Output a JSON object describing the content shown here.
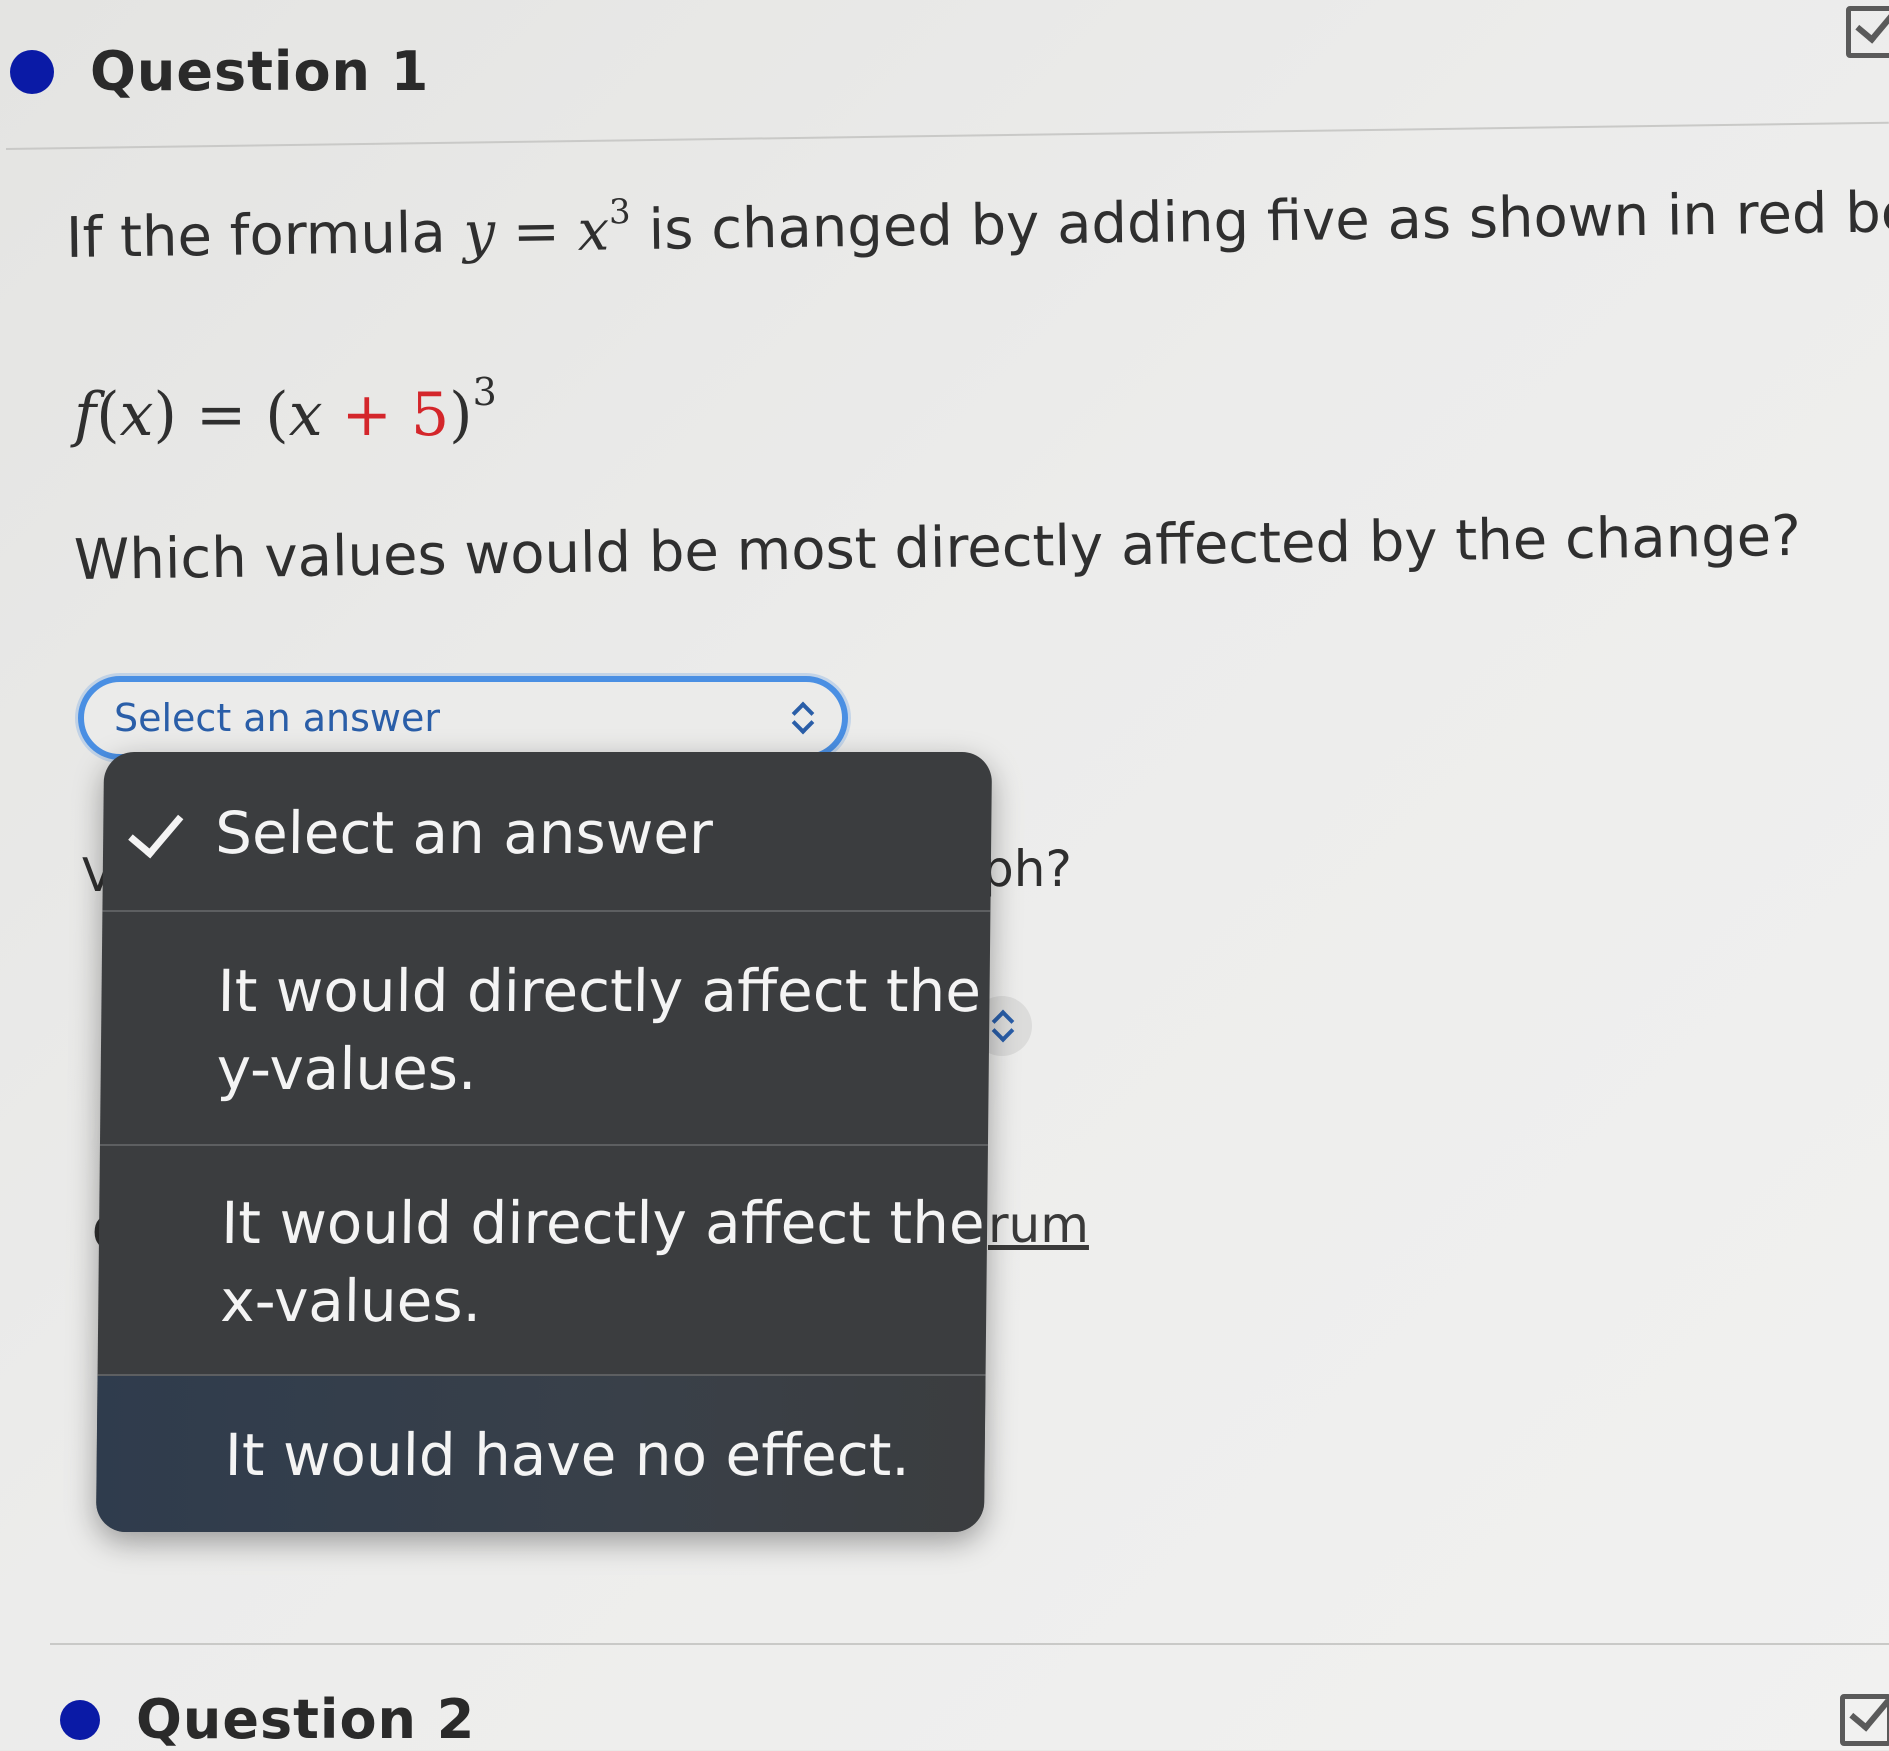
{
  "question1": {
    "title": "Question 1",
    "prompt_before": "If the formula ",
    "prompt_math_y": "y",
    "prompt_math_eq": " = ",
    "prompt_math_x": "x",
    "prompt_math_exp": "3",
    "prompt_after": " is changed by adding five as shown in red below.",
    "formula_left": "f",
    "formula_paren_open": "(",
    "formula_x": "x",
    "formula_paren_close": ") = (",
    "formula_x2": "x",
    "formula_added": " + 5",
    "formula_close": ")",
    "formula_exp": "3",
    "question_text": "Which values would be most directly affected by the change?",
    "select": {
      "selected_label": "Select an answer"
    },
    "menu": {
      "options": [
        {
          "label": "Select an answer",
          "checked": true
        },
        {
          "label": "It would directly affect the",
          "label_line2": "y-values."
        },
        {
          "label": "It would directly affect the",
          "label_line2": "x-values."
        },
        {
          "label": "It would have no effect."
        }
      ]
    },
    "background_fragments": {
      "ph": "ph?",
      "rum": "rum",
      "v": "V",
      "c": "C"
    }
  },
  "question2": {
    "title": "Question 2"
  },
  "colors": {
    "accent_blue": "#4a8fe3",
    "bullet": "#0a1aa6",
    "formula_red": "#d4262b",
    "menu_bg": "#3b3d3f"
  },
  "icons": [
    "bullet-dot-icon",
    "checkbox-icon",
    "updown-chevron-icon",
    "checkmark-icon"
  ]
}
